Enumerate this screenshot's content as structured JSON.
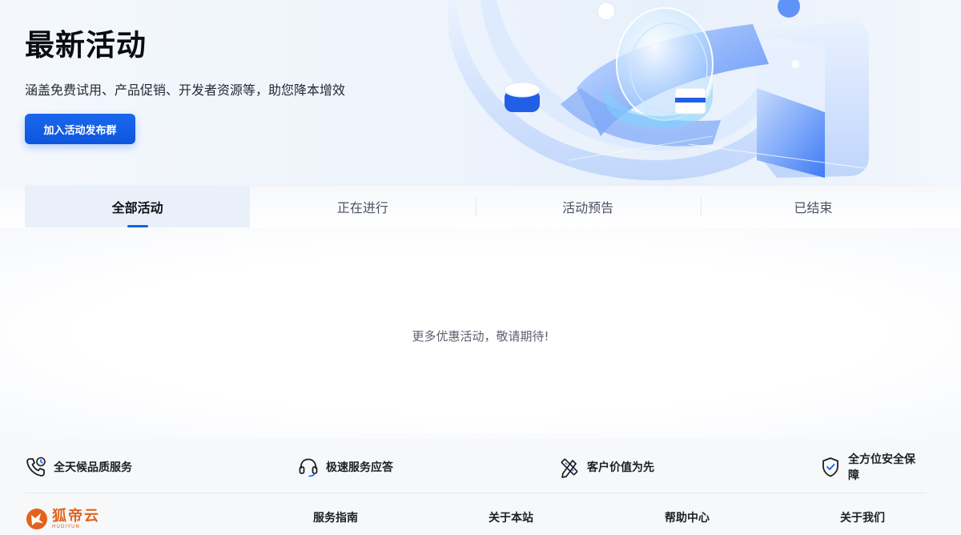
{
  "hero": {
    "title": "最新活动",
    "subtitle": "涵盖免费试用、产品促销、开发者资源等，助您降本增效",
    "button_label": "加入活动发布群"
  },
  "tabs": [
    {
      "label": "全部活动",
      "active": true
    },
    {
      "label": "正在进行",
      "active": false
    },
    {
      "label": "活动预告",
      "active": false
    },
    {
      "label": "已结束",
      "active": false
    }
  ],
  "content": {
    "empty_message": "更多优惠活动，敬请期待!"
  },
  "features": [
    {
      "label": "全天候品质服务",
      "icon": "phone-clock-icon"
    },
    {
      "label": "极速服务应答",
      "icon": "headset-icon"
    },
    {
      "label": "客户价值为先",
      "icon": "pencil-ruler-icon"
    },
    {
      "label": "全方位安全保障",
      "icon": "shield-check-icon"
    }
  ],
  "footer": {
    "logo_text": "狐帝云",
    "logo_en": "HUDIYUN",
    "links": [
      "服务指南",
      "关于本站",
      "帮助中心",
      "关于我们"
    ]
  },
  "colors": {
    "accent": "#1660e8",
    "logo": "#e2631c"
  }
}
